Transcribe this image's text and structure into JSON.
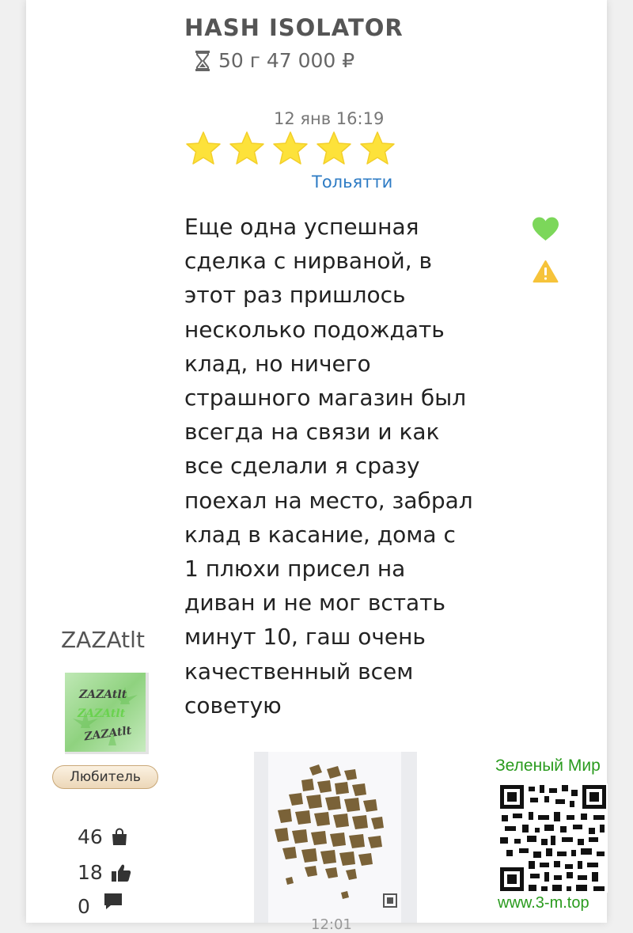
{
  "product": {
    "title": "HASH ISOLATOR",
    "meta": "50 г 47 000 ₽",
    "meta_icon": "hourglass-icon"
  },
  "review": {
    "date": "12 янв 16:19",
    "rating": 5,
    "rating_max": 5,
    "city": "Тольятти",
    "text": "Еще одна успешная\nсделка с нирваной, в\nэтот раз пришлось\nнесколько подождать\nклад, но ничего\nстрашного магазин был\nвсегда на связи и как\nвсе сделали я сразу\nпоехал на место, забрал\nклад в касание, дома с\n1 плюхи присел на\nдиван и не мог встать\nминут 10, гаш очень\nкачественный всем\nсоветую",
    "photo_caption": "12:01"
  },
  "actions": {
    "like_icon": "heart-icon",
    "report_icon": "warning-icon"
  },
  "user": {
    "name": "ZAZAtlt",
    "avatar_text": [
      "ZAZAtlt",
      "ZAZAtlt",
      "ZAZAtlt"
    ],
    "rank": "Любитель",
    "purchases": "46",
    "likes": "18",
    "comments": "0"
  },
  "watermark": {
    "title": "Зеленый Мир",
    "url": "www.3-m.top"
  },
  "colors": {
    "star": "#fde23a",
    "like": "#7cd75a",
    "warning": "#f6c33a",
    "city_link": "#2d7bc4",
    "watermark": "#2a9b1e"
  }
}
